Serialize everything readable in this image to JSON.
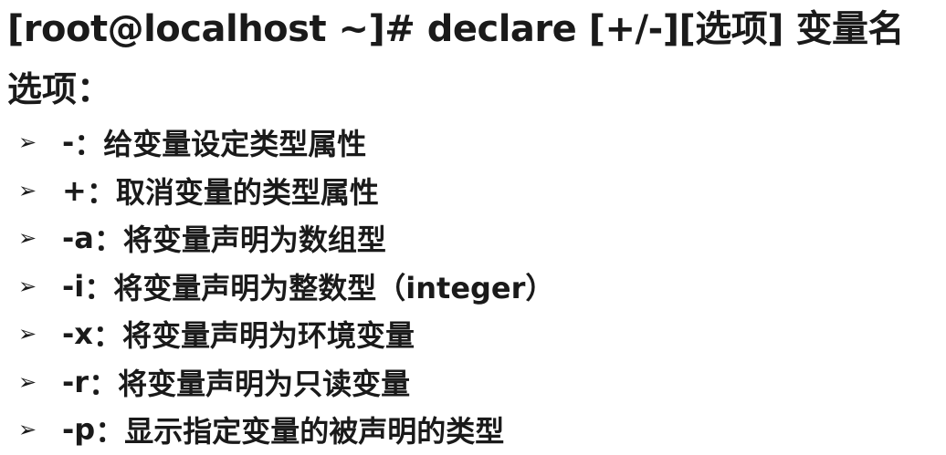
{
  "command_line": "[root@localhost ~]# declare [+/-][选项] 变量名",
  "section_label": "选项：",
  "bullet_icon": "➢",
  "separator": "：",
  "options": [
    {
      "flag": "-",
      "desc": "给变量设定类型属性"
    },
    {
      "flag": "+",
      "desc": "取消变量的类型属性"
    },
    {
      "flag": "-a",
      "desc": "将变量声明为数组型"
    },
    {
      "flag": "-i",
      "desc": "将变量声明为整数型（integer）"
    },
    {
      "flag": "-x",
      "desc": "将变量声明为环境变量"
    },
    {
      "flag": "-r",
      "desc": "将变量声明为只读变量"
    },
    {
      "flag": "-p",
      "desc": "显示指定变量的被声明的类型"
    }
  ]
}
